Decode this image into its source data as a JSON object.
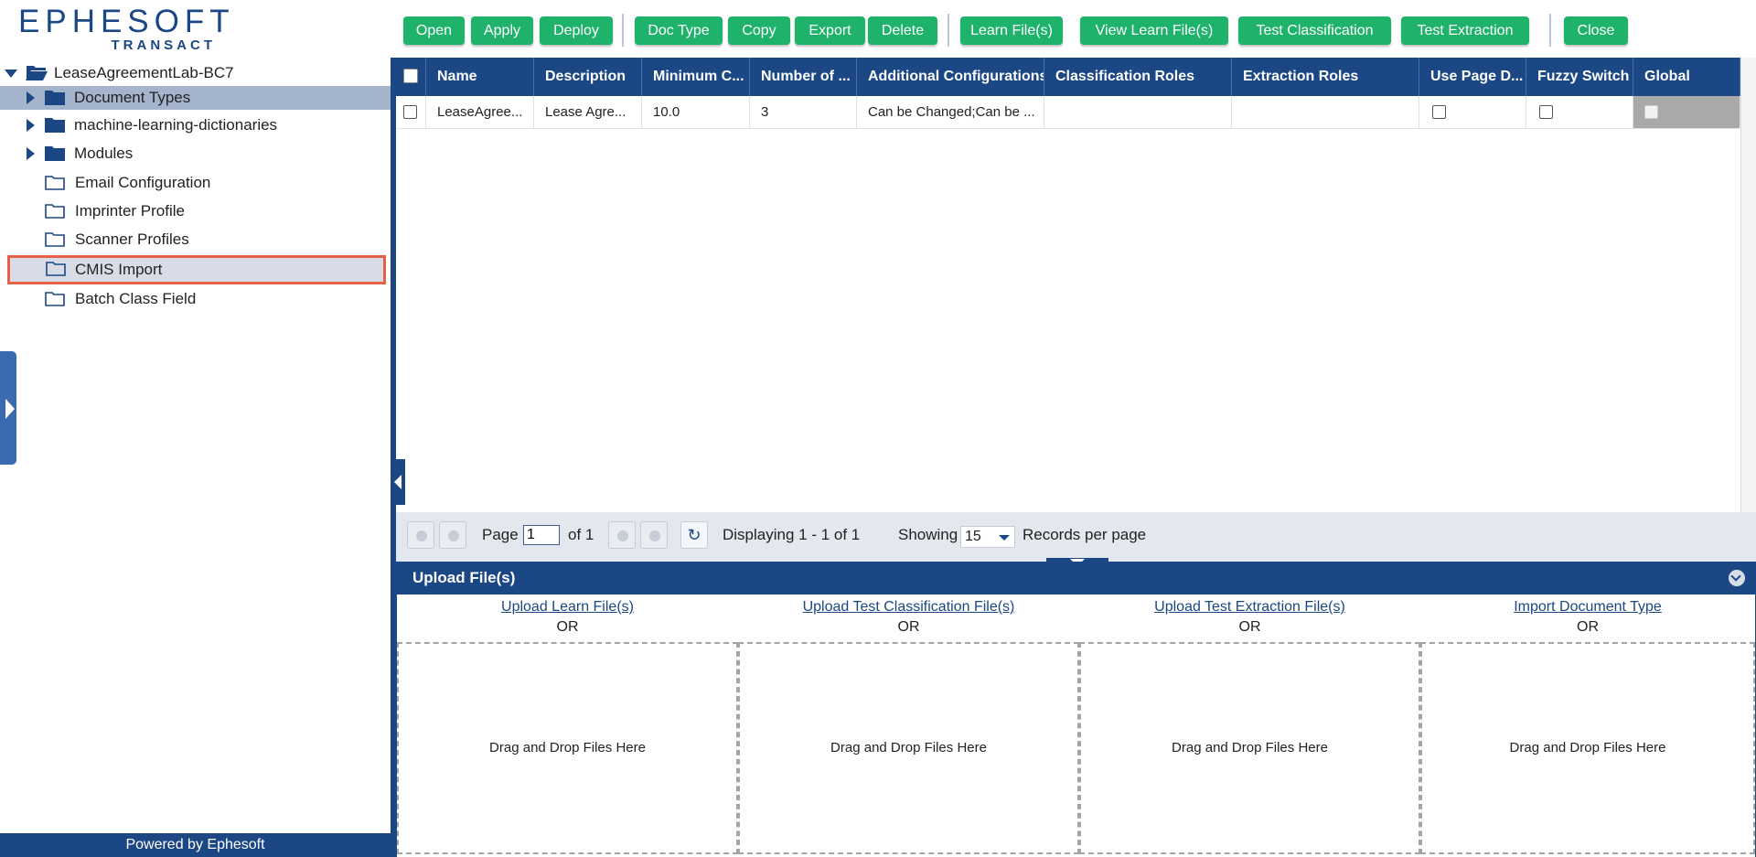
{
  "logo": {
    "line1": "EPHESOFT",
    "line2": "TRANSACT"
  },
  "tree": {
    "root": "LeaseAgreementLab-BC7",
    "items": [
      {
        "label": "Document Types"
      },
      {
        "label": "machine-learning-dictionaries"
      },
      {
        "label": "Modules"
      },
      {
        "label": "Email Configuration"
      },
      {
        "label": "Imprinter Profile"
      },
      {
        "label": "Scanner Profiles"
      },
      {
        "label": "CMIS Import"
      },
      {
        "label": "Batch Class Field"
      }
    ]
  },
  "footer": {
    "powered": "Powered by Ephesoft"
  },
  "toolbar": {
    "open": "Open",
    "apply": "Apply",
    "deploy": "Deploy",
    "doc_type": "Doc Type",
    "copy": "Copy",
    "export": "Export",
    "delete": "Delete",
    "learn_files": "Learn File(s)",
    "view_learn_files": "View Learn File(s)",
    "test_classification": "Test Classification",
    "test_extraction": "Test Extraction",
    "close": "Close"
  },
  "grid": {
    "headers": [
      "Name",
      "Description",
      "Minimum C...",
      "Number of ...",
      "Additional Configurations",
      "Classification Roles",
      "Extraction Roles",
      "Use Page D...",
      "Fuzzy Switch",
      "Global"
    ],
    "rows": [
      {
        "name": "LeaseAgree...",
        "description": "Lease Agre...",
        "minimum": "10.0",
        "number": "3",
        "additional": "Can be Changed;Can be ...",
        "classification_roles": "",
        "extraction_roles": ""
      }
    ]
  },
  "pager": {
    "page_label": "Page",
    "page_value": "1",
    "of_label": "of 1",
    "displaying": "Displaying 1 - 1 of 1",
    "showing": "Showing",
    "per_page": "15",
    "records": "Records per page"
  },
  "upload": {
    "title": "Upload File(s)",
    "columns": [
      {
        "link": "Upload Learn File(s)",
        "or": "OR",
        "drop": "Drag and Drop Files Here"
      },
      {
        "link": "Upload Test Classification File(s)",
        "or": "OR",
        "drop": "Drag and Drop Files Here"
      },
      {
        "link": "Upload Test Extraction File(s)",
        "or": "OR",
        "drop": "Drag and Drop Files Here"
      },
      {
        "link": "Import Document Type",
        "or": "OR",
        "drop": "Drag and Drop Files Here"
      }
    ]
  },
  "colors": {
    "brand": "#1b4784",
    "button": "#1fb26b",
    "highlight": "#e46148"
  }
}
